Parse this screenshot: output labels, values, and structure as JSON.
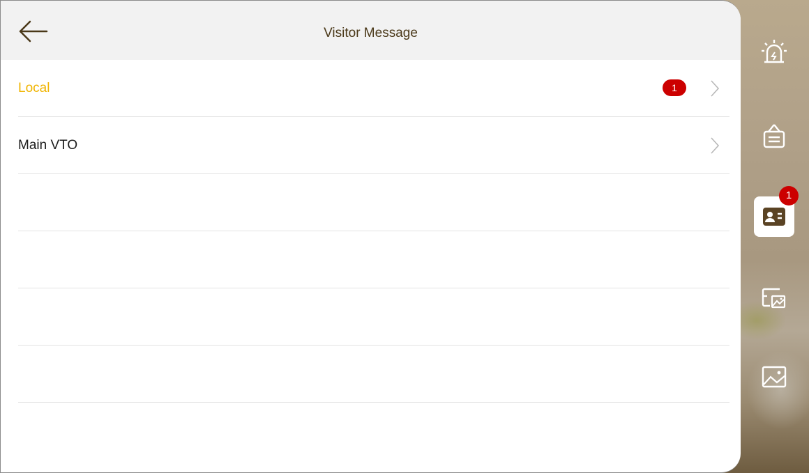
{
  "header": {
    "title": "Visitor Message"
  },
  "list": {
    "rows": [
      {
        "label": "Local",
        "badge": "1"
      },
      {
        "label": "Main VTO"
      }
    ]
  },
  "rail": {
    "items": [
      {
        "icon": "alarm-icon"
      },
      {
        "icon": "notice-board-icon"
      },
      {
        "icon": "visitor-card-icon",
        "badge": "1",
        "selected": true
      },
      {
        "icon": "snapshot-gallery-icon"
      },
      {
        "icon": "picture-icon"
      }
    ]
  },
  "colors": {
    "active_row": "#f0b400",
    "badge": "#cc0000",
    "icon": "#ffffff",
    "title": "#4a3818"
  }
}
